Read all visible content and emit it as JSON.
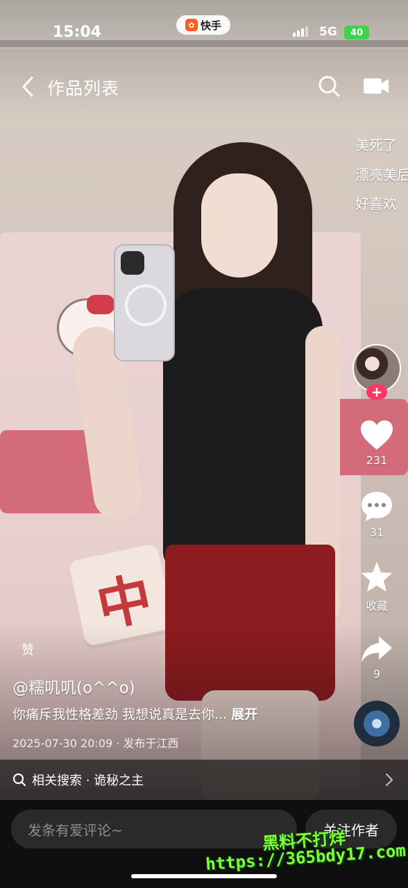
{
  "status_bar": {
    "time": "15:04",
    "app_pill": "快手",
    "network": "5G",
    "battery": "40"
  },
  "nav": {
    "title": "作品列表"
  },
  "danmaku": [
    "美死了",
    "漂亮美后",
    "好喜欢"
  ],
  "actions": {
    "like_count": "231",
    "comment_count": "31",
    "collect_label": "收藏",
    "share_count": "9",
    "follow_plus": "+"
  },
  "caption": {
    "badge": "赞",
    "author": "@糯叽叽(o^^o)",
    "text": "你痛斥我性格差劲 我想说真是去你...",
    "expand": "展开",
    "meta": "2025-07-30 20:09 · 发布于江西"
  },
  "related_search": {
    "label": "相关搜索 · 诡秘之主"
  },
  "bottom": {
    "comment_placeholder": "发条有爱评论~",
    "follow_author": "关注作者"
  },
  "watermark": {
    "line1": "黑料不打烊",
    "line2": "https://365bdy17.com"
  },
  "colors": {
    "follow_plus_bg": "#fe3666",
    "watermark": "#7dff3a",
    "battery": "#3fd34b"
  }
}
